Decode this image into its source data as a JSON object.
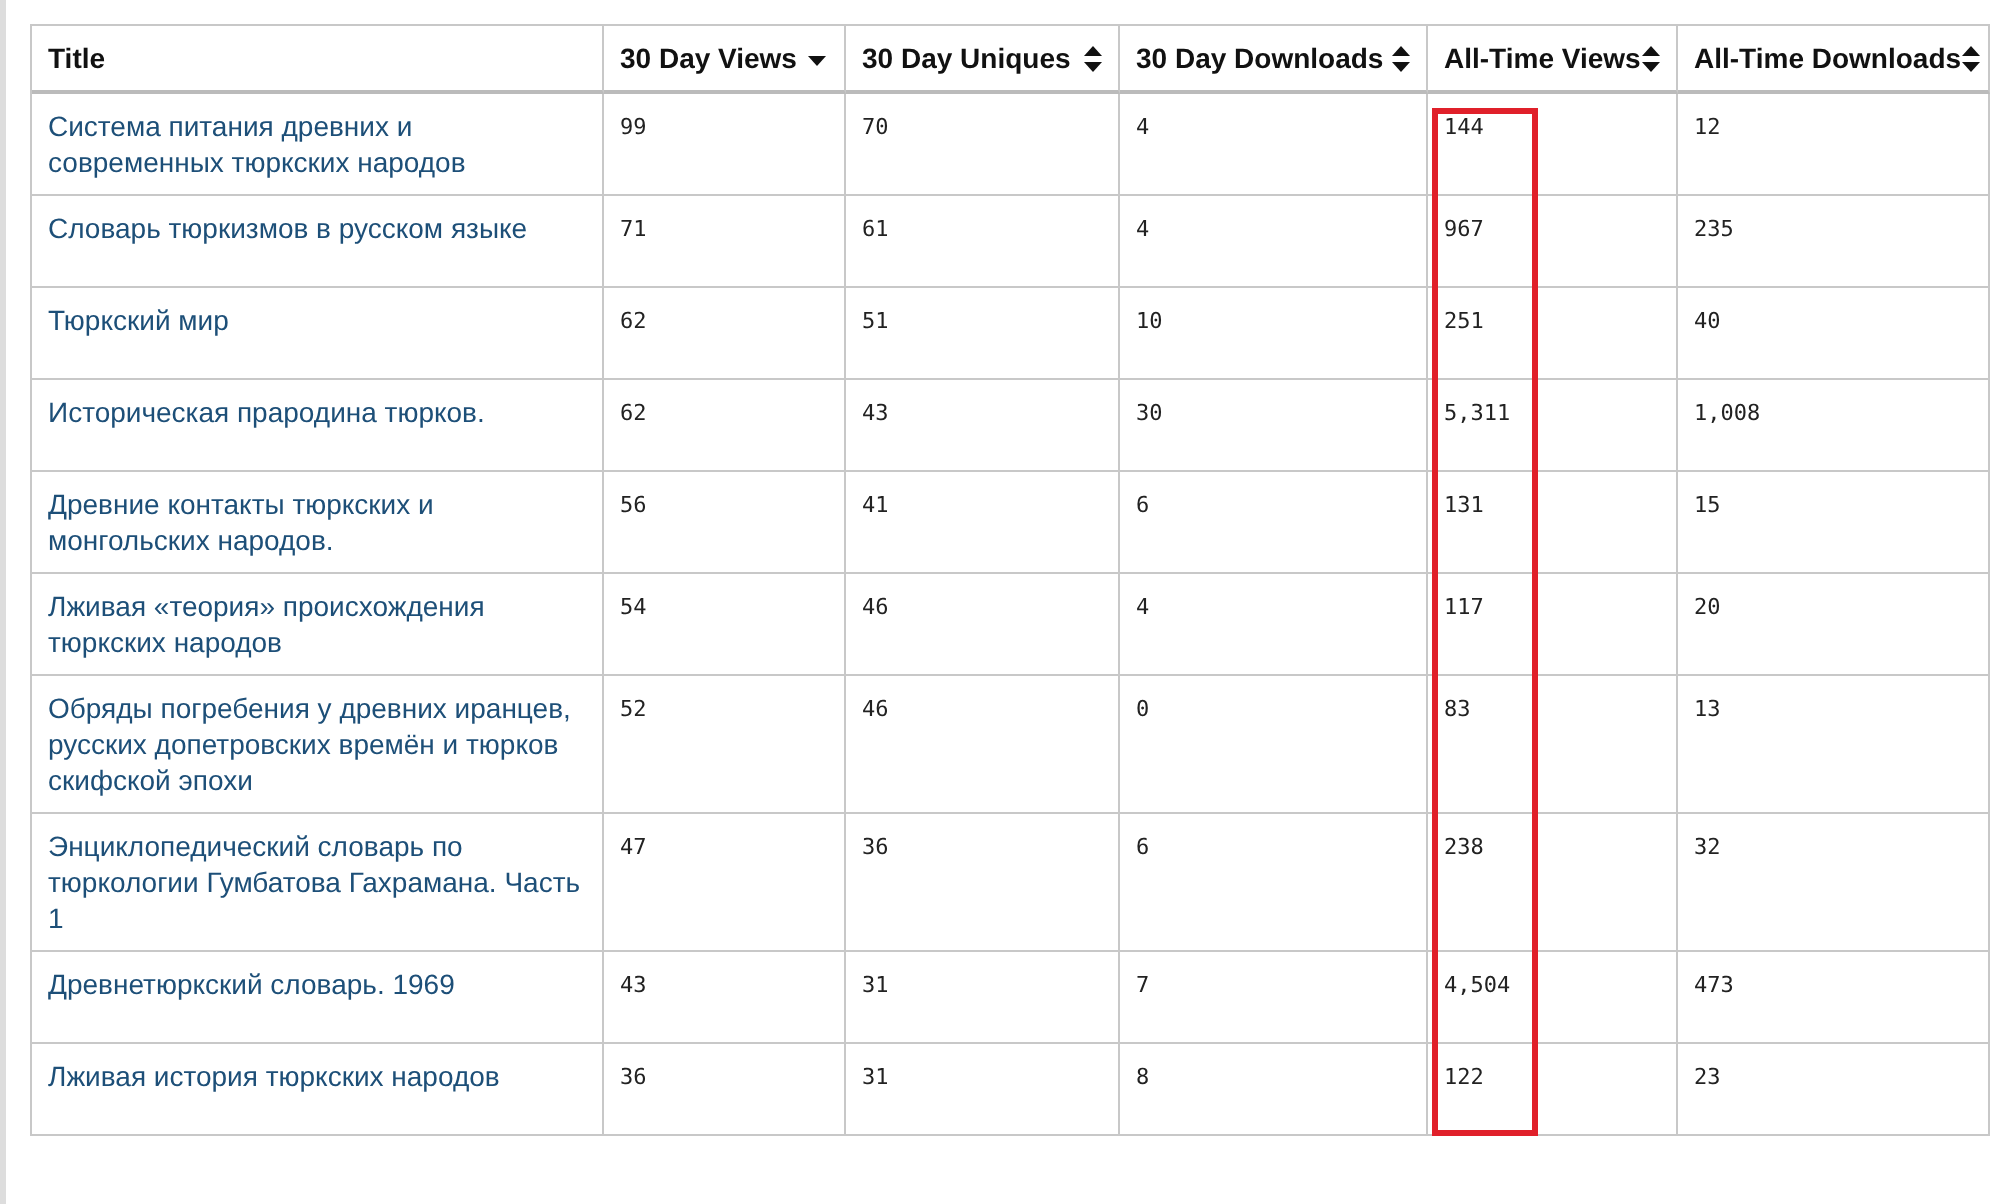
{
  "table": {
    "columns": [
      {
        "label": "Title",
        "sortable": false,
        "highlighted": false
      },
      {
        "label": "30 Day Views",
        "sortable": true,
        "sorted_descending": true,
        "highlighted": false
      },
      {
        "label": "30 Day Uniques",
        "sortable": true,
        "sorted_descending": false,
        "highlighted": false
      },
      {
        "label": "30 Day Downloads",
        "sortable": true,
        "sorted_descending": false,
        "highlighted": false
      },
      {
        "label": "All-Time Views",
        "sortable": true,
        "sorted_descending": false,
        "highlighted": true
      },
      {
        "label": "All-Time Downloads",
        "sortable": true,
        "sorted_descending": false,
        "highlighted": false
      }
    ],
    "rows": [
      [
        "Система питания древних и современных тюркских народов",
        "99",
        "70",
        "4",
        "144",
        "12"
      ],
      [
        "Словарь тюркизмов в русском языке",
        "71",
        "61",
        "4",
        "967",
        "235"
      ],
      [
        "Тюркский мир",
        "62",
        "51",
        "10",
        "251",
        "40"
      ],
      [
        "Историческая прародина тюрков.",
        "62",
        "43",
        "30",
        "5,311",
        "1,008"
      ],
      [
        "Древние контакты тюркских и монгольских народов.",
        "56",
        "41",
        "6",
        "131",
        "15"
      ],
      [
        "Лживая «теория» происхождения тюркских народов",
        "54",
        "46",
        "4",
        "117",
        "20"
      ],
      [
        "Обряды погребения у древних иранцев, русских допетровских времён и тюрков скифской эпохи",
        "52",
        "46",
        "0",
        "83",
        "13"
      ],
      [
        "Энциклопедический словарь по тюркологии Гумбатова Гахрамана. Часть 1",
        "47",
        "36",
        "6",
        "238",
        "32"
      ],
      [
        "Древнетюркский словарь. 1969",
        "43",
        "31",
        "7",
        "4,504",
        "473"
      ],
      [
        "Лживая история тюркских народов",
        "36",
        "31",
        "8",
        "122",
        "23"
      ]
    ]
  }
}
